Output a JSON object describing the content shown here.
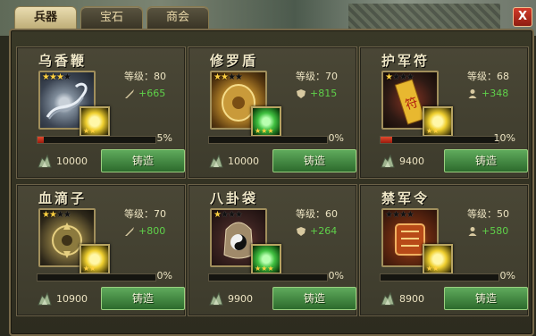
{
  "tabs": [
    {
      "label": "兵器",
      "active": true
    },
    {
      "label": "宝石",
      "active": false
    },
    {
      "label": "商会",
      "active": false
    }
  ],
  "close_label": "X",
  "forge_label": "铸造",
  "colors": {
    "panel_bg": "#3d3b2c",
    "button_green": "#3f8a3d",
    "bonus_green": "#5fd14a",
    "progress_red": "#d23a22",
    "star_gold": "#ffd040"
  },
  "items": [
    {
      "name": "乌香鞭",
      "level": "等级：80",
      "bonus": "+665",
      "bonus_icon": "weapon-icon",
      "stars_filled": 3,
      "gem": "yellow-gem-icon",
      "gem_stars": 2,
      "progress_pct": 5,
      "progress_label": "5%",
      "cost": "10000"
    },
    {
      "name": "修罗盾",
      "level": "等级：70",
      "bonus": "+815",
      "bonus_icon": "shield-icon",
      "stars_filled": 2,
      "gem": "green-gem-icon",
      "gem_stars": 3,
      "progress_pct": 0,
      "progress_label": "0%",
      "cost": "10000"
    },
    {
      "name": "护军符",
      "level": "等级：68",
      "bonus": "+348",
      "bonus_icon": "soldier-icon",
      "stars_filled": 1,
      "gem": "yellow-gem-icon",
      "gem_stars": 2,
      "progress_pct": 10,
      "progress_label": "10%",
      "cost": "9400"
    },
    {
      "name": "血滴子",
      "level": "等级：70",
      "bonus": "+800",
      "bonus_icon": "weapon-icon",
      "stars_filled": 2,
      "gem": "yellow-gem-icon",
      "gem_stars": 2,
      "progress_pct": 0,
      "progress_label": "0%",
      "cost": "10900"
    },
    {
      "name": "八卦袋",
      "level": "等级：60",
      "bonus": "+264",
      "bonus_icon": "shield-icon",
      "stars_filled": 1,
      "gem": "green-gem-icon",
      "gem_stars": 3,
      "progress_pct": 0,
      "progress_label": "0%",
      "cost": "9900"
    },
    {
      "name": "禁军令",
      "level": "等级：50",
      "bonus": "+580",
      "bonus_icon": "soldier-icon",
      "stars_filled": 0,
      "gem": "yellow-gem-icon",
      "gem_stars": 2,
      "progress_pct": 0,
      "progress_label": "0%",
      "cost": "8900"
    }
  ]
}
